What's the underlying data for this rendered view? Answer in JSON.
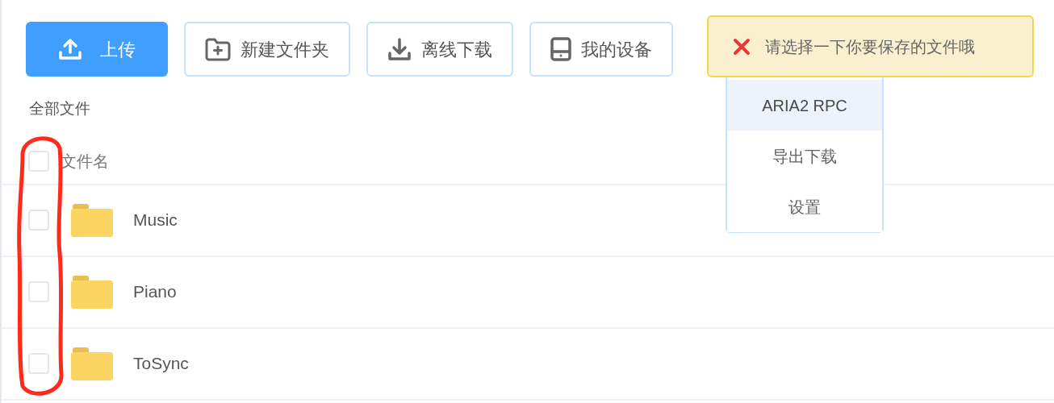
{
  "toolbar": [
    {
      "kind": "upload",
      "label": "上传",
      "primary": true
    },
    {
      "kind": "folder",
      "label": "新建文件夹",
      "primary": false
    },
    {
      "kind": "download",
      "label": "离线下载",
      "primary": false
    },
    {
      "kind": "device",
      "label": "我的设备",
      "primary": false
    }
  ],
  "toast": {
    "kind": "error",
    "message": "请选择一下你要保存的文件哦"
  },
  "dropdown": {
    "items": [
      {
        "label": "ARIA2 RPC",
        "selected": true
      },
      {
        "label": "导出下载",
        "selected": false
      },
      {
        "label": "设置",
        "selected": false
      }
    ]
  },
  "breadcrumb": "全部文件",
  "table": {
    "header": {
      "label": "文件名",
      "checked": false
    },
    "rows": [
      {
        "name": "Music",
        "kind": "folder",
        "checked": false
      },
      {
        "name": "Piano",
        "kind": "folder",
        "checked": false
      },
      {
        "name": "ToSync",
        "kind": "folder",
        "checked": false
      }
    ]
  },
  "annotation": {
    "kind": "outline"
  }
}
